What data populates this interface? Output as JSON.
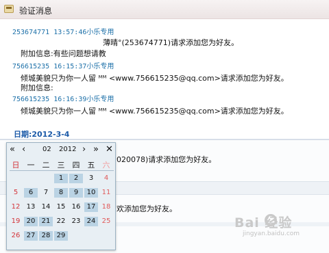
{
  "window": {
    "title": "验证消息"
  },
  "messages": [
    {
      "header": "253674771  13:57:46小乐专用",
      "body": "薄晴°(253674771)请求添加您为好友。",
      "extra": "附加信息:有些问题想请教"
    },
    {
      "header": "756615235  16:15:37小乐专用",
      "body": "倾城美貌只为你一人留 ᴹᴹ <www.756615235@qq.com>请求添加您为好友。",
      "extra": "附加信息:"
    },
    {
      "header": "756615235  16:16:39小乐专用",
      "body": "倾城美貌只为你一人留 ᴹᴹ <www.756615235@qq.com>请求添加您为好友。"
    }
  ],
  "date": {
    "label": "日期:",
    "value": "2012-3-4"
  },
  "lower_fragments": [
    "020078)请求添加您为好友。",
    "欢添加您为好友。"
  ],
  "calendar": {
    "nav": {
      "first": "«",
      "prev": "‹",
      "next": "›",
      "last": "»",
      "close": "✕"
    },
    "month": "02",
    "year": "2012",
    "weekdays": [
      "日",
      "一",
      "二",
      "三",
      "四",
      "五",
      "六"
    ],
    "weeks": [
      [
        null,
        null,
        null,
        1,
        2,
        3,
        4
      ],
      [
        5,
        6,
        7,
        8,
        9,
        10,
        11
      ],
      [
        12,
        13,
        14,
        15,
        16,
        17,
        18
      ],
      [
        19,
        20,
        21,
        22,
        23,
        24,
        25
      ],
      [
        26,
        27,
        28,
        29,
        null,
        null,
        null
      ]
    ],
    "highlighted": [
      1,
      2,
      6,
      8,
      9,
      10,
      17,
      20,
      21,
      24,
      27,
      28,
      29
    ]
  },
  "watermark": {
    "logo": "Bai 经验",
    "url": "jingyan.baidu.com"
  }
}
